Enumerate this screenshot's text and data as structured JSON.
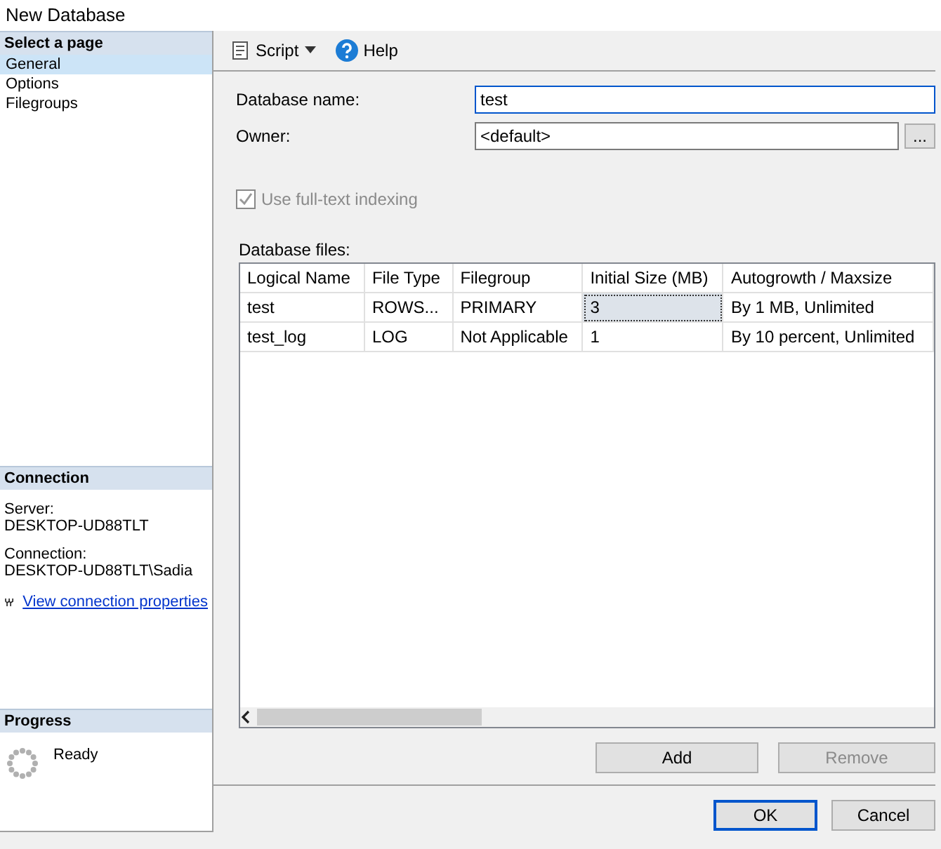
{
  "window": {
    "title": "New Database"
  },
  "sidebar": {
    "header": "Select a page",
    "pages": [
      {
        "label": "General",
        "selected": true
      },
      {
        "label": "Options",
        "selected": false
      },
      {
        "label": "Filegroups",
        "selected": false
      }
    ],
    "connection": {
      "header": "Connection",
      "server_label": "Server:",
      "server": "DESKTOP-UD88TLT",
      "connection_label": "Connection:",
      "connection": "DESKTOP-UD88TLT\\Sadia",
      "link": "View connection properties"
    },
    "progress": {
      "header": "Progress",
      "status": "Ready"
    }
  },
  "toolbar": [
    {
      "label": "Script",
      "kind": "dropdown"
    },
    {
      "label": "Help",
      "kind": "help"
    }
  ],
  "form": {
    "name_label": "Database name:",
    "name_value": "test",
    "name_focused": true,
    "owner_label": "Owner:",
    "owner_value": "<default>",
    "browse": "...",
    "fulltext": {
      "label": "Use full-text indexing",
      "checked": true,
      "disabled": true
    }
  },
  "files": {
    "label": "Database files:",
    "columns": [
      "Logical Name",
      "File Type",
      "Filegroup",
      "Initial Size (MB)",
      "Autogrowth / Maxsize"
    ],
    "rows": [
      {
        "cells": [
          "test",
          "ROWS...",
          "PRIMARY",
          "3",
          "By 1 MB, Unlimited"
        ],
        "editing": true
      },
      {
        "cells": [
          "test_log",
          "LOG",
          "Not Applicable",
          "1",
          "By 10 percent, Unlimited"
        ],
        "editing": false
      }
    ]
  },
  "grid_buttons": [
    {
      "label": "Add",
      "disabled": false
    },
    {
      "label": "Remove",
      "disabled": true
    }
  ],
  "dialog_buttons": [
    {
      "label": "OK",
      "default": true
    },
    {
      "label": "Cancel",
      "default": false
    }
  ]
}
